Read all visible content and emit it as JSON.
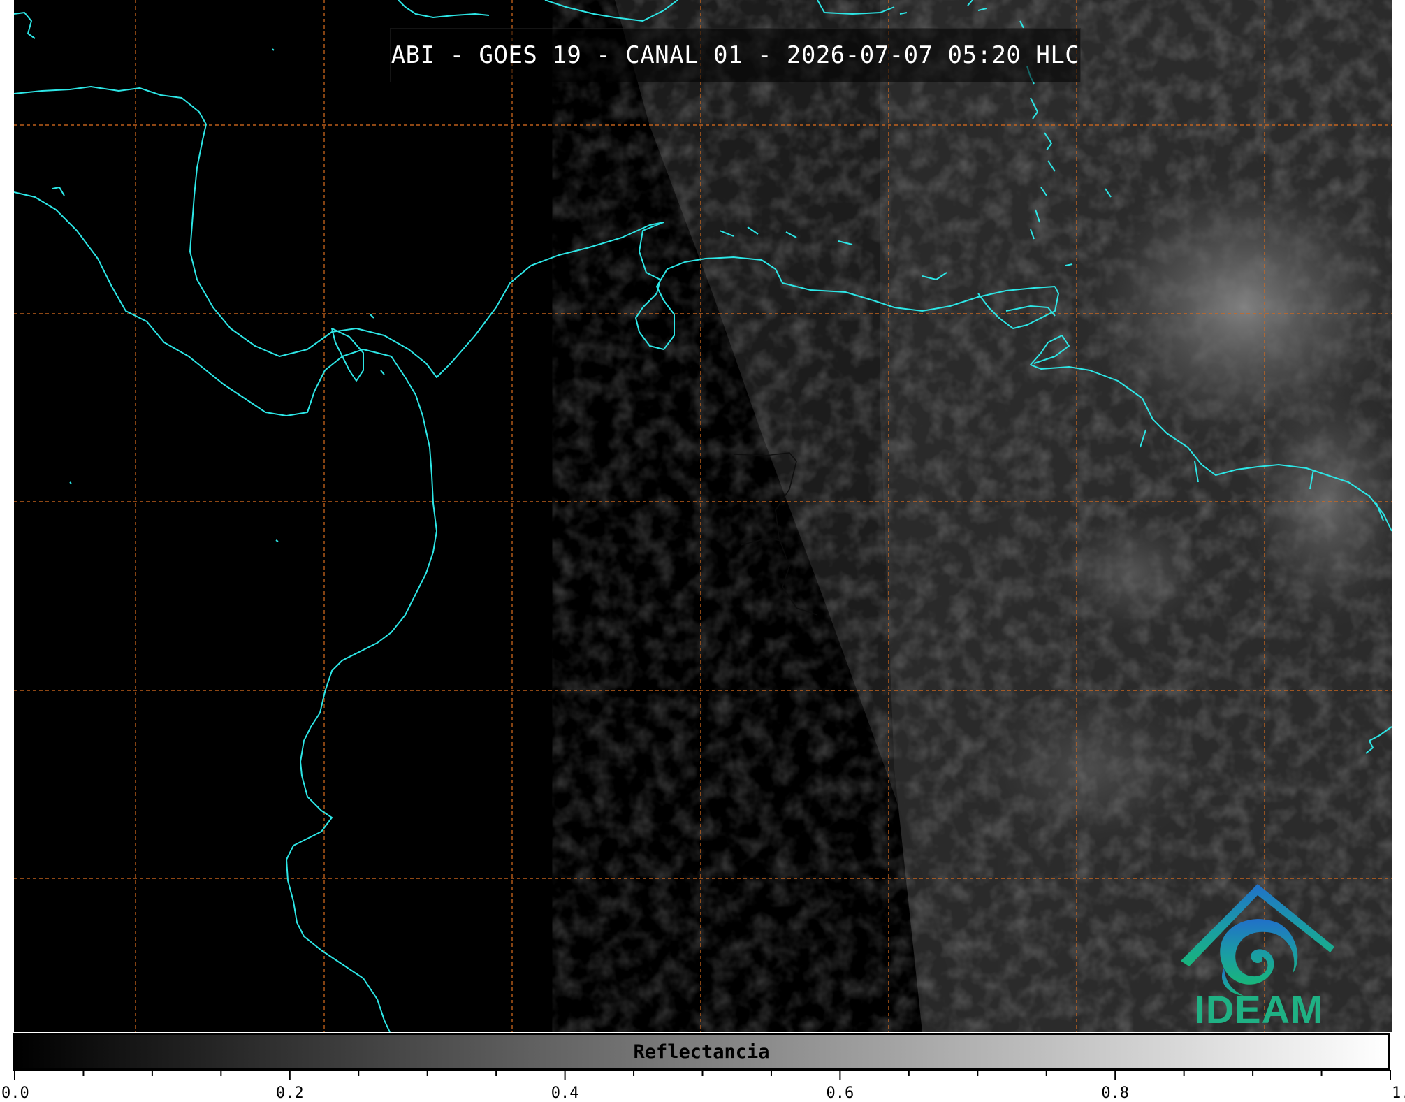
{
  "title": "ABI - GOES 19 - CANAL 01 - 2026-07-07 05:20 HLC",
  "logo": {
    "text": "IDEAM",
    "icon": "ideam-logo-icon"
  },
  "colorbar": {
    "label": "Reflectancia",
    "range": [
      0.0,
      1.0
    ],
    "major_ticks": [
      "0.0",
      "0.2",
      "0.4",
      "0.6",
      "0.8",
      "1.0"
    ],
    "minor_tick_step": 0.05,
    "gradient": [
      "#000000",
      "#ffffff"
    ]
  },
  "colors": {
    "coastline": "#2de6e6",
    "gridlines": "#d2691e",
    "borders": "#111111"
  }
}
